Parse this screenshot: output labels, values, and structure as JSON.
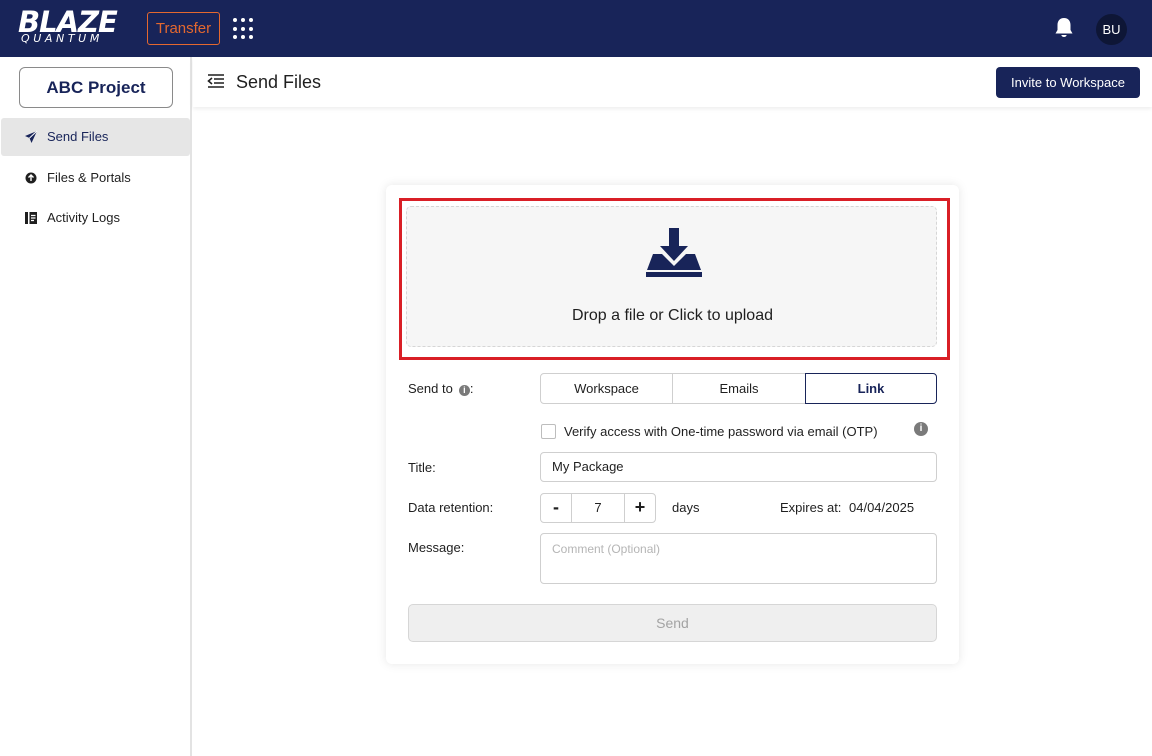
{
  "topbar": {
    "logo_main": "BLAZE",
    "logo_sub": "QUANTUM",
    "product_label": "Transfer",
    "user_initials": "BU"
  },
  "sidebar": {
    "project_label": "ABC Project",
    "items": [
      {
        "label": "Send Files",
        "icon": "send-icon",
        "active": true
      },
      {
        "label": "Files & Portals",
        "icon": "files-portals-icon",
        "active": false
      },
      {
        "label": "Activity Logs",
        "icon": "activity-log-icon",
        "active": false
      }
    ]
  },
  "header": {
    "title": "Send Files",
    "invite_label": "Invite to Workspace"
  },
  "upload": {
    "prompt": "Drop a file or Click to upload"
  },
  "form": {
    "send_to_label": "Send to",
    "send_to_suffix": ":",
    "send_to_options": [
      "Workspace",
      "Emails",
      "Link"
    ],
    "send_to_selected": "Link",
    "otp_label": "Verify access with One-time password via email (OTP)",
    "otp_checked": false,
    "title_label": "Title:",
    "title_value": "My Package",
    "retention_label": "Data retention:",
    "retention_minus": "-",
    "retention_value": "7",
    "retention_plus": "+",
    "retention_unit": "days",
    "expires_label": "Expires at:",
    "expires_value": "04/04/2025",
    "message_label": "Message:",
    "message_placeholder": "Comment (Optional)",
    "send_label": "Send"
  },
  "colors": {
    "navy": "#182459",
    "accent_orange": "#e4682f",
    "highlight_red": "#d91f26"
  }
}
